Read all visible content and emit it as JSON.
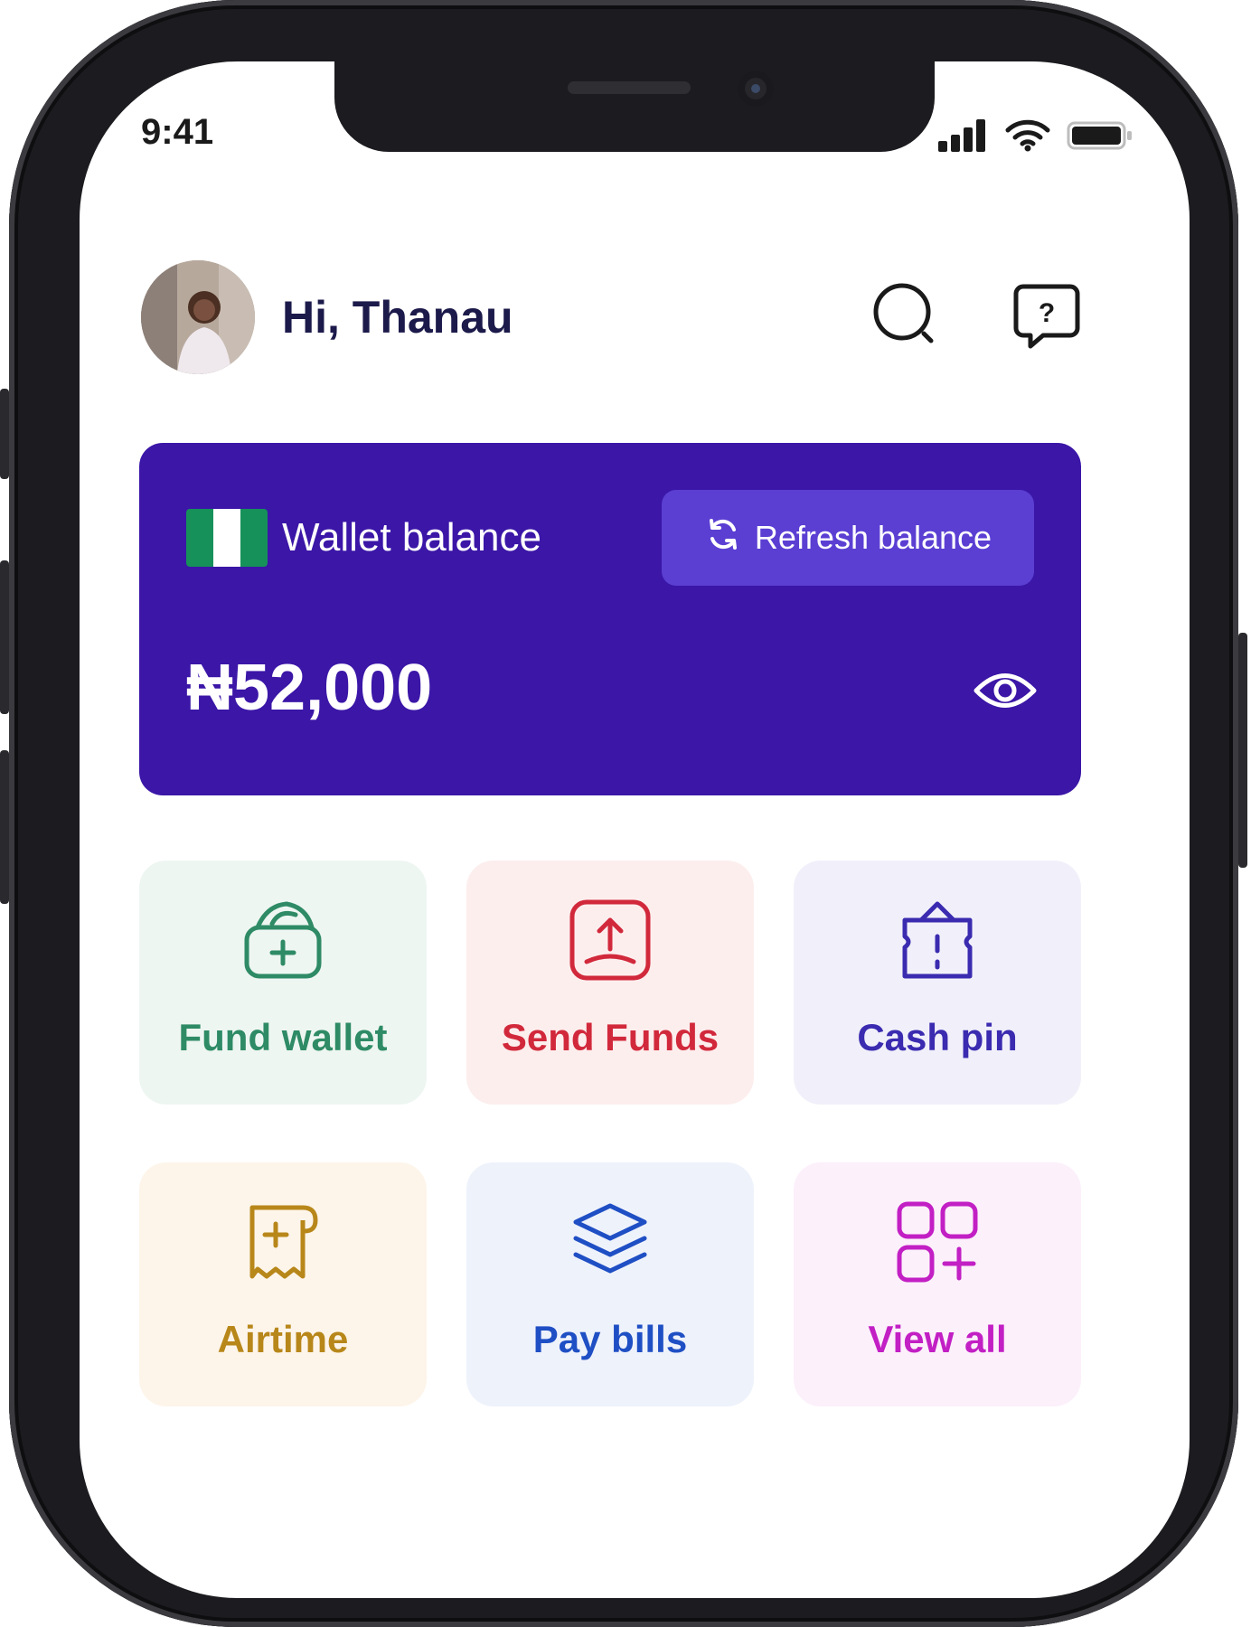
{
  "status_bar": {
    "time": "9:41"
  },
  "header": {
    "greeting": "Hi, Thanau",
    "search_icon": "search-icon",
    "help_icon": "help-chat-icon"
  },
  "wallet": {
    "label": "Wallet balance",
    "refresh_label": "Refresh balance",
    "amount": "₦52,000",
    "flag": "nigeria-flag",
    "card_color": "#3b16a7",
    "refresh_color": "#5b3fd3"
  },
  "actions": [
    {
      "label": "Fund wallet",
      "icon": "wallet-add-icon",
      "color": "#2e8b65",
      "bg": "#eef6f2"
    },
    {
      "label": "Send Funds",
      "icon": "upload-icon",
      "color": "#d1293b",
      "bg": "#fdeeee"
    },
    {
      "label": "Cash pin",
      "icon": "cash-pin-icon",
      "color": "#3a2bb0",
      "bg": "#f1f0fa"
    },
    {
      "label": "Airtime",
      "icon": "airtime-receipt-icon",
      "color": "#b8871a",
      "bg": "#fdf5ea"
    },
    {
      "label": "Pay bills",
      "icon": "layers-icon",
      "color": "#1f4fc4",
      "bg": "#eef2fb"
    },
    {
      "label": "View all",
      "icon": "grid-add-icon",
      "color": "#c21fc4",
      "bg": "#fcf0fb"
    }
  ]
}
